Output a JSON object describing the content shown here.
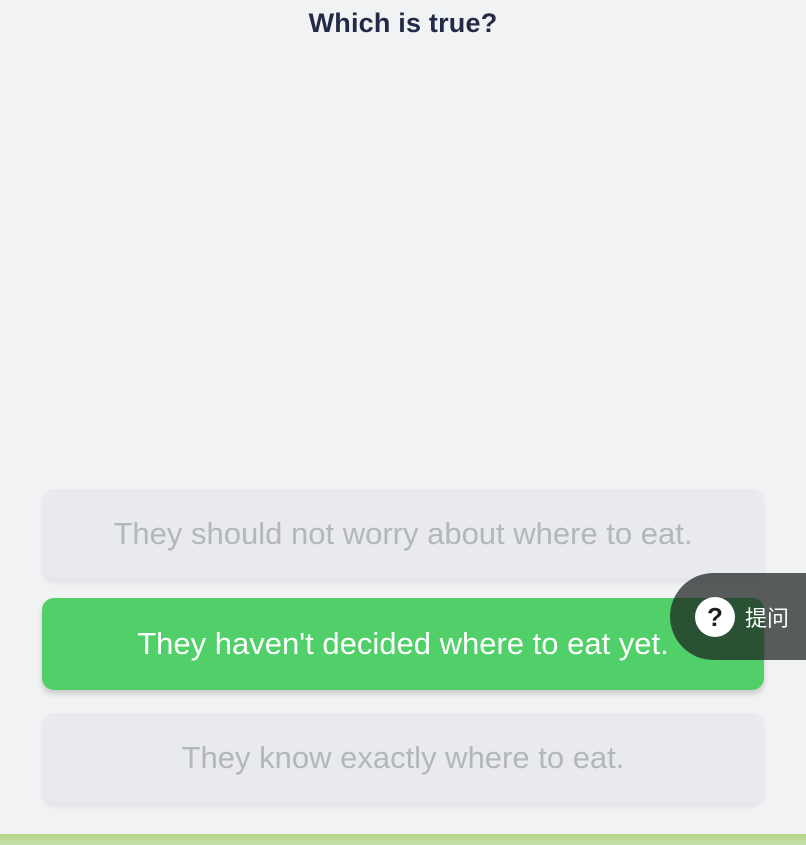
{
  "question": "Which is true?",
  "options": [
    {
      "label": "They should not worry about where to eat.",
      "state": "inactive"
    },
    {
      "label": "They haven't decided where to eat yet.",
      "state": "selected"
    },
    {
      "label": "They know exactly where to eat.",
      "state": "inactive"
    }
  ],
  "ask_button": {
    "icon": "question-mark-icon",
    "icon_glyph": "?",
    "label": "提问"
  },
  "colors": {
    "background": "#f1f2f4",
    "selected": "#51d069",
    "inactive": "#e9eaed",
    "inactive_text": "#b4b6bd",
    "question_text": "#222a45"
  }
}
